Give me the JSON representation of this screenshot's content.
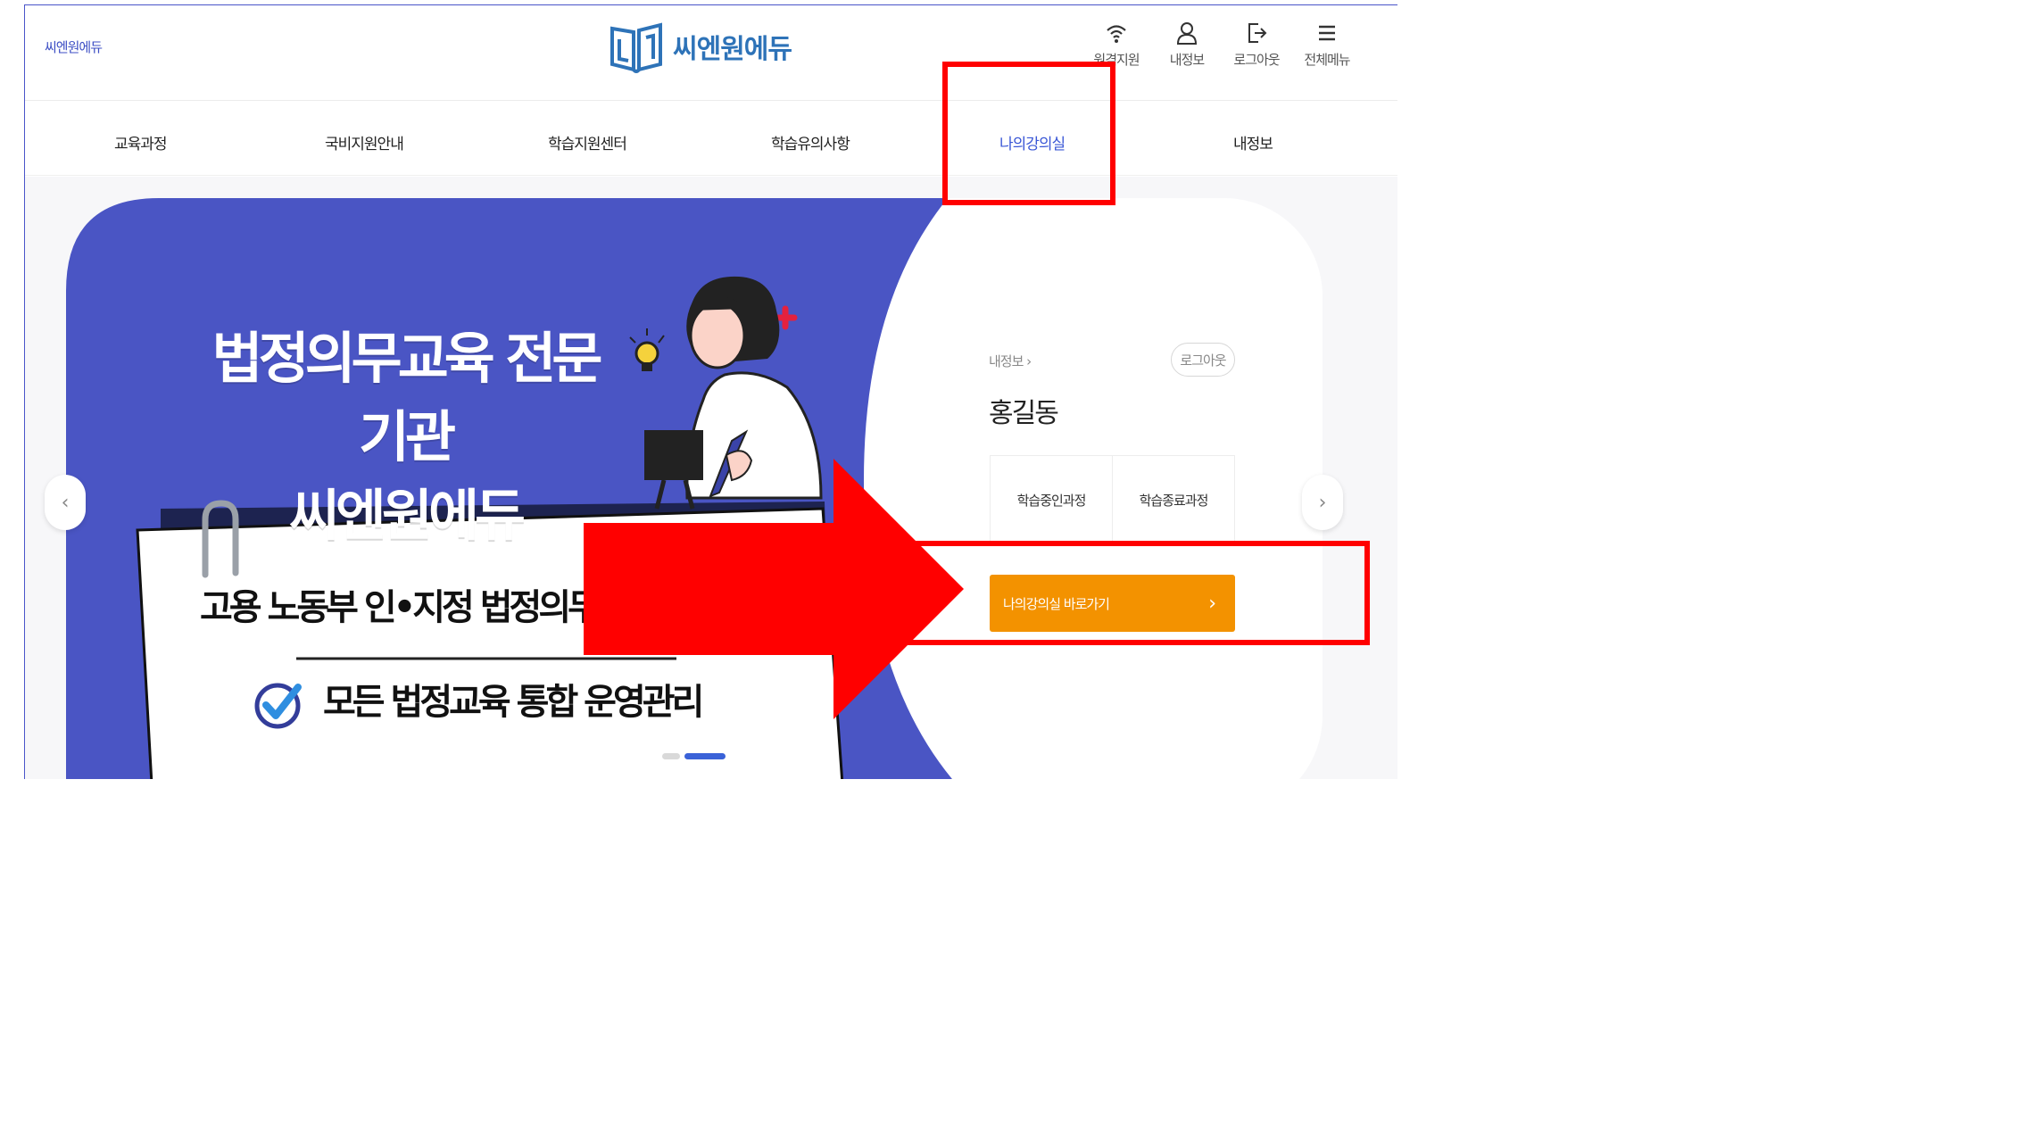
{
  "header": {
    "site_name": "씨엔원에듀",
    "logo_text": "씨엔원에듀",
    "utility": [
      {
        "label": "원격지원",
        "icon": "wifi-icon"
      },
      {
        "label": "내정보",
        "icon": "user-icon"
      },
      {
        "label": "로그아웃",
        "icon": "logout-icon"
      },
      {
        "label": "전체메뉴",
        "icon": "menu-icon"
      }
    ]
  },
  "gnb": [
    "교육과정",
    "국비지원안내",
    "학습지원센터",
    "학습유의사항",
    "나의강의실",
    "내정보"
  ],
  "gnb_active": "나의강의실",
  "hero": {
    "title_line1": "법정의무교육 전문기관",
    "title_line2": "씨엔원에듀",
    "note_line1": "고용 노동부 인•지정 법정의무교육",
    "note_line2": "모든 법정교육 통합 운영관리"
  },
  "card": {
    "info_label": "내정보 ›",
    "logout": "로그아웃",
    "name": "홍길동",
    "stats": [
      "학습중인과정",
      "학습종료과정"
    ],
    "cta_label": "나의강의실 바로가기",
    "cta_chevron": "›"
  },
  "slider": {
    "prev": "‹",
    "next": "›"
  },
  "colors": {
    "brand_blue": "#4a55c4",
    "accent_orange": "#f39200",
    "annotation_red": "#ff0000",
    "active_menu": "#3a57d6"
  }
}
